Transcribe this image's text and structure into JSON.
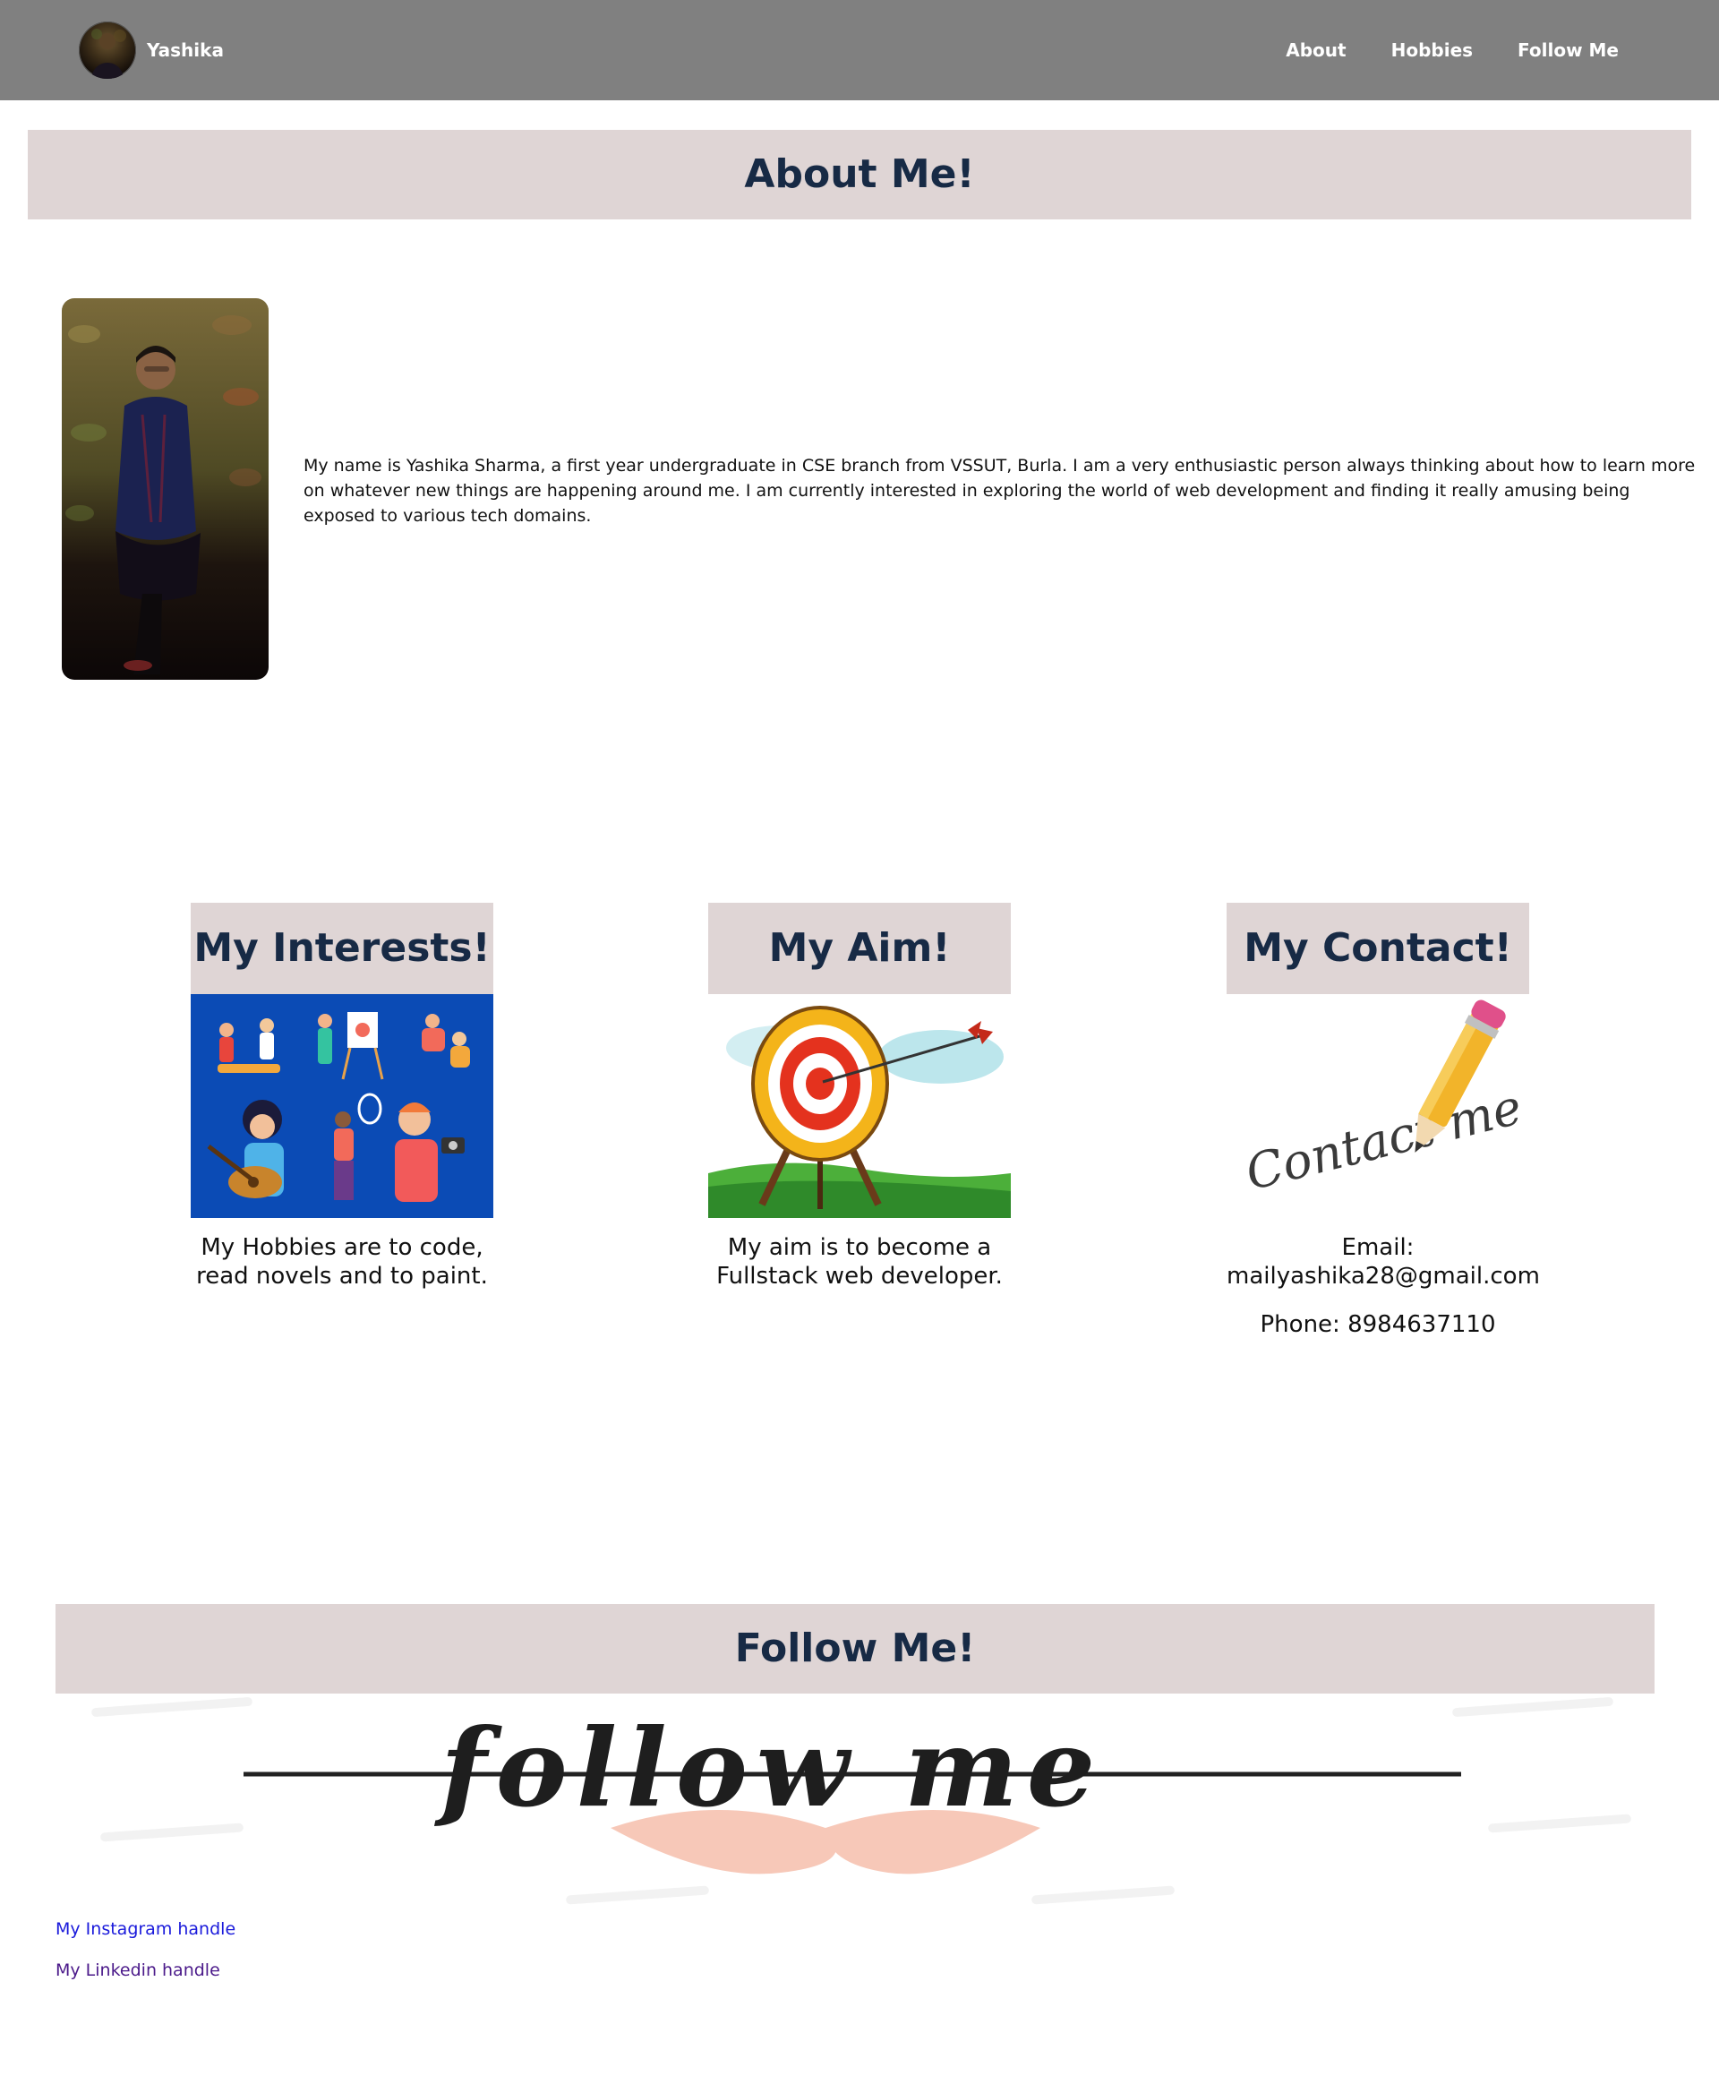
{
  "navbar": {
    "brand_name": "Yashika",
    "links": [
      "About",
      "Hobbies",
      "Follow Me"
    ],
    "background": "#808080"
  },
  "about": {
    "heading": "About Me!",
    "paragraph": "My name is Yashika Sharma, a first year undergraduate in CSE branch from VSSUT, Burla. I am a very enthusiastic person always thinking about how to learn more on whatever new things are happening around me. I am currently interested in exploring the world of web development and finding it really amusing being exposed to various tech domains."
  },
  "cards": [
    {
      "title": "My Interests!",
      "text_lines": [
        "My Hobbies are to code,",
        "read novels and to paint."
      ]
    },
    {
      "title": "My Aim!",
      "text_lines": [
        "My aim is to become a",
        "Fullstack web developer."
      ]
    },
    {
      "title": "My Contact!",
      "text_lines": [
        "Email:",
        "mailyashika28@gmail.com",
        "Phone: 8984637110"
      ],
      "image_text": "Contact me"
    }
  ],
  "follow": {
    "heading": "Follow Me!",
    "image_text": "follow me",
    "links": [
      "My Instagram handle",
      "My Linkedin handle"
    ]
  },
  "colors": {
    "heading_bar": "#dfd5d5",
    "heading_text": "#172a45",
    "link_blue": "#1a1adb",
    "link_visited": "#4b1a8a"
  }
}
